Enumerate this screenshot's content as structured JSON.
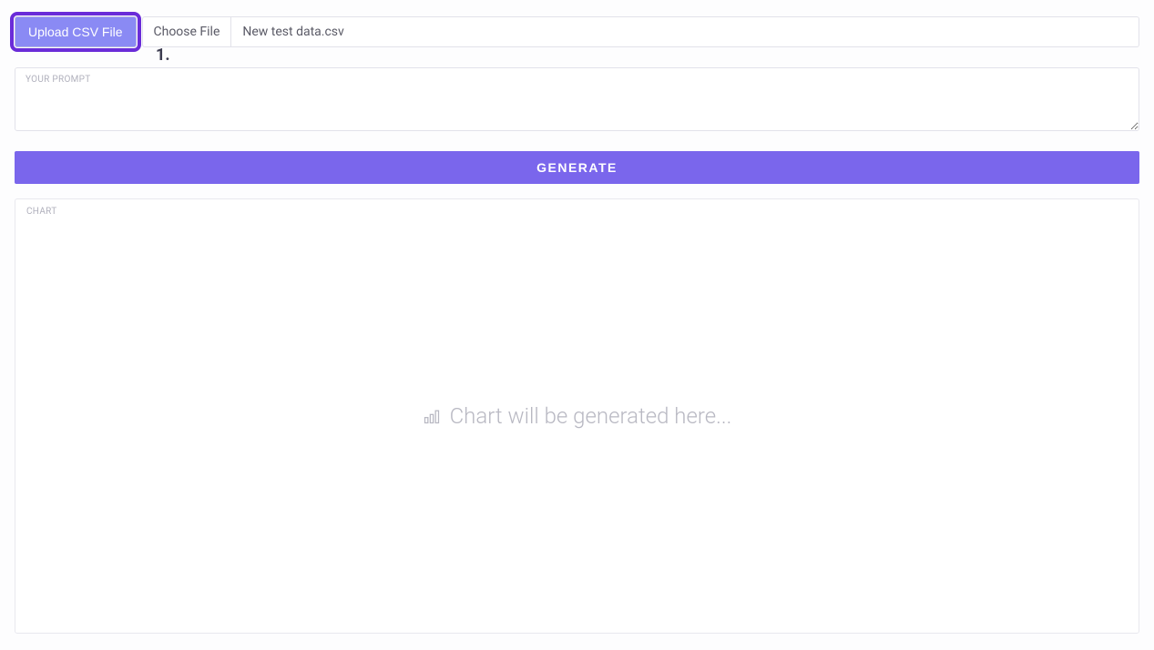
{
  "upload": {
    "button_label": "Upload CSV File",
    "choose_label": "Choose File",
    "file_name": "New test data.csv",
    "annotation": "1."
  },
  "prompt": {
    "label": "YOUR PROMPT",
    "value": ""
  },
  "generate": {
    "label": "GENERATE"
  },
  "chart": {
    "label": "CHART",
    "placeholder": "Chart will be generated here..."
  }
}
